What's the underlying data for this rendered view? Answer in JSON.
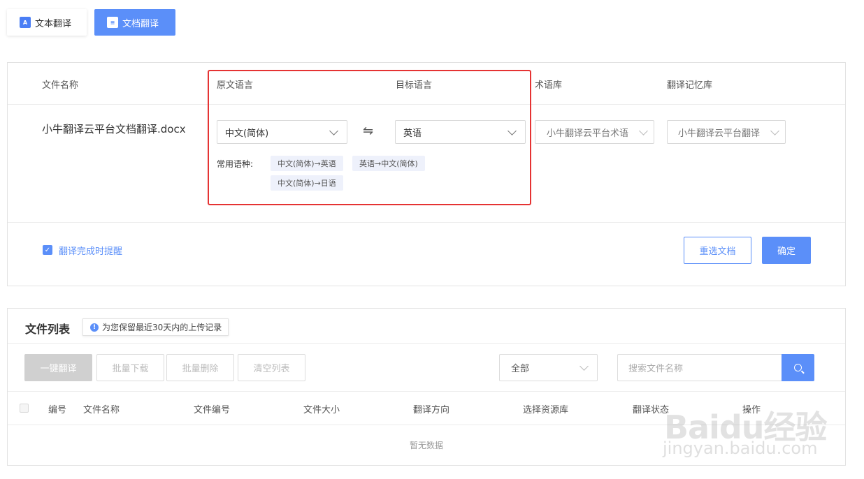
{
  "tabs": [
    {
      "label": "文本翻译",
      "icon": "text-translate-icon"
    },
    {
      "label": "文档翻译",
      "icon": "document-translate-icon"
    }
  ],
  "upload": {
    "headers": {
      "filename": "文件名称",
      "source_lang": "原文语言",
      "target_lang": "目标语言",
      "terminology": "术语库",
      "memory": "翻译记忆库"
    },
    "file_name": "小牛翻译云平台文档翻译.docx",
    "source_value": "中文(简体)",
    "target_value": "英语",
    "terminology_value": "小牛翻译云平台术语",
    "memory_value": "小牛翻译云平台翻译",
    "common_label": "常用语种:",
    "common_pairs": [
      "中文(简体)→英语",
      "英语→中文(简体)",
      "中文(简体)→日语"
    ],
    "notify_label": "翻译完成时提醒",
    "notify_checked": true,
    "reselect_label": "重选文档",
    "confirm_label": "确定"
  },
  "file_list": {
    "title": "文件列表",
    "notice": "为您保留最近30天内的上传记录",
    "toolbar": {
      "translate_all": "一键翻译",
      "batch_download": "批量下载",
      "batch_delete": "批量删除",
      "clear_list": "清空列表"
    },
    "filter_value": "全部",
    "search_placeholder": "搜索文件名称",
    "columns": [
      "编号",
      "文件名称",
      "文件编号",
      "文件大小",
      "翻译方向",
      "选择资源库",
      "翻译状态",
      "操作"
    ],
    "empty_text": "暂无数据"
  },
  "watermark": {
    "logo": "Baidu经验",
    "url": "jingyan.baidu.com"
  },
  "colors": {
    "accent": "#5b8ff9",
    "highlight_box": "#e53333"
  }
}
